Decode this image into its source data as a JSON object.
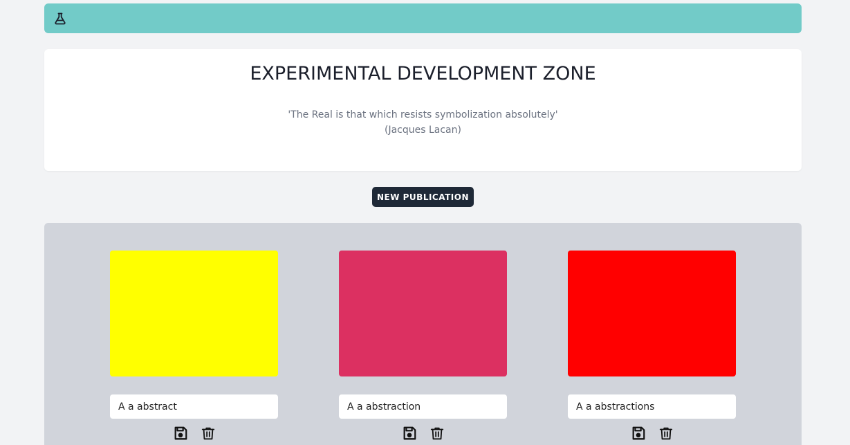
{
  "header": {
    "icon": "flask-icon",
    "background_color": "#72cbc8"
  },
  "hero": {
    "title": "EXPERIMENTAL DEVELOPMENT ZONE",
    "quote": "'The Real is that which resists symbolization absolutely'",
    "author": "(Jacques Lacan)"
  },
  "actions": {
    "new_publication_label": "NEW PUBLICATION"
  },
  "gallery": {
    "cards": [
      {
        "color": "#ffff00",
        "title": "A a abstract"
      },
      {
        "color": "#dc3061",
        "title": "A a abstraction"
      },
      {
        "color": "#ff0000",
        "title": "A a abstractions"
      }
    ],
    "save_icon": "floppy-disk-icon",
    "delete_icon": "trash-icon"
  }
}
